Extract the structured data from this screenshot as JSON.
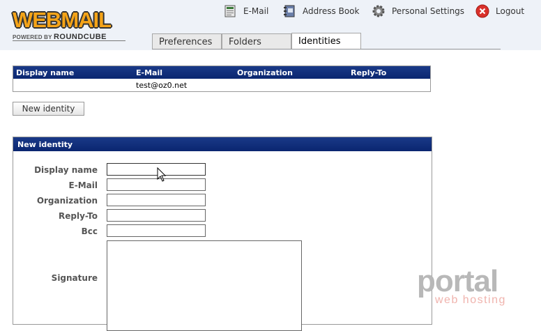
{
  "app": {
    "logo_main": "WEBMAIL",
    "logo_powered": "POWERED BY",
    "logo_brand": "ROUNDCUBE"
  },
  "topnav": [
    {
      "label": "E-Mail",
      "icon": "mail-icon"
    },
    {
      "label": "Address Book",
      "icon": "address-book-icon"
    },
    {
      "label": "Personal Settings",
      "icon": "gear-icon"
    },
    {
      "label": "Logout",
      "icon": "logout-icon"
    }
  ],
  "tabs": [
    {
      "label": "Preferences",
      "active": false
    },
    {
      "label": "Folders",
      "active": false
    },
    {
      "label": "Identities",
      "active": true
    }
  ],
  "identities_table": {
    "columns": [
      "Display name",
      "E-Mail",
      "Organization",
      "Reply-To"
    ],
    "rows": [
      {
        "display_name": "",
        "email": "test@oz0.net",
        "organization": "",
        "reply_to": ""
      }
    ]
  },
  "new_identity_button": "New identity",
  "form": {
    "title": "New identity",
    "fields": {
      "display_name": {
        "label": "Display name",
        "value": ""
      },
      "email": {
        "label": "E-Mail",
        "value": ""
      },
      "organization": {
        "label": "Organization",
        "value": ""
      },
      "reply_to": {
        "label": "Reply-To",
        "value": ""
      },
      "bcc": {
        "label": "Bcc",
        "value": ""
      },
      "signature": {
        "label": "Signature",
        "value": ""
      }
    }
  },
  "watermark": {
    "brand": "portal",
    "tagline": "web hosting"
  },
  "colors": {
    "header_bar": "#0a2670",
    "logo_orange": "#f5a418",
    "logout_red": "#d9302a"
  }
}
